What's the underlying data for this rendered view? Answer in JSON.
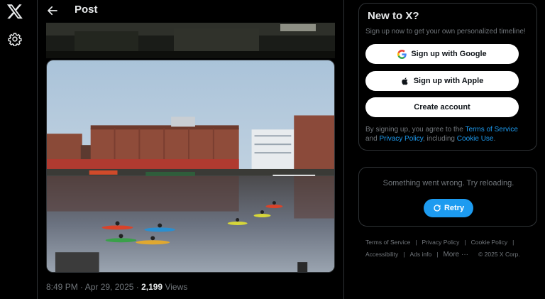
{
  "rail": {
    "logo_icon": "x-logo-icon",
    "settings_icon": "gear-icon"
  },
  "header": {
    "title": "Post",
    "back_icon": "arrow-left-icon"
  },
  "post": {
    "time": "8:49 PM · Apr 29, 2025 · ",
    "views_count": "2,199",
    "views_label": " Views"
  },
  "signup": {
    "title": "New to X?",
    "subtitle": "Sign up now to get your own personalized timeline!",
    "google_label": "Sign up with Google",
    "apple_label": "Sign up with Apple",
    "create_label": "Create account",
    "legal_prefix": "By signing up, you agree to the ",
    "terms": "Terms of Service",
    "legal_and": " and ",
    "privacy": "Privacy Policy",
    "legal_including": ", including ",
    "cookie": "Cookie Use",
    "legal_end": "."
  },
  "error": {
    "message": "Something went wrong. Try reloading.",
    "retry_label": "Retry"
  },
  "footer": {
    "terms": "Terms of Service",
    "privacy": "Privacy Policy",
    "cookie": "Cookie Policy",
    "accessibility": "Accessibility",
    "ads": "Ads info",
    "more": "More ···",
    "copyright": "© 2025 X Corp."
  },
  "colors": {
    "accent": "#1d9bf0",
    "background": "#000000",
    "border": "#2f3336",
    "muted": "#71767b"
  }
}
